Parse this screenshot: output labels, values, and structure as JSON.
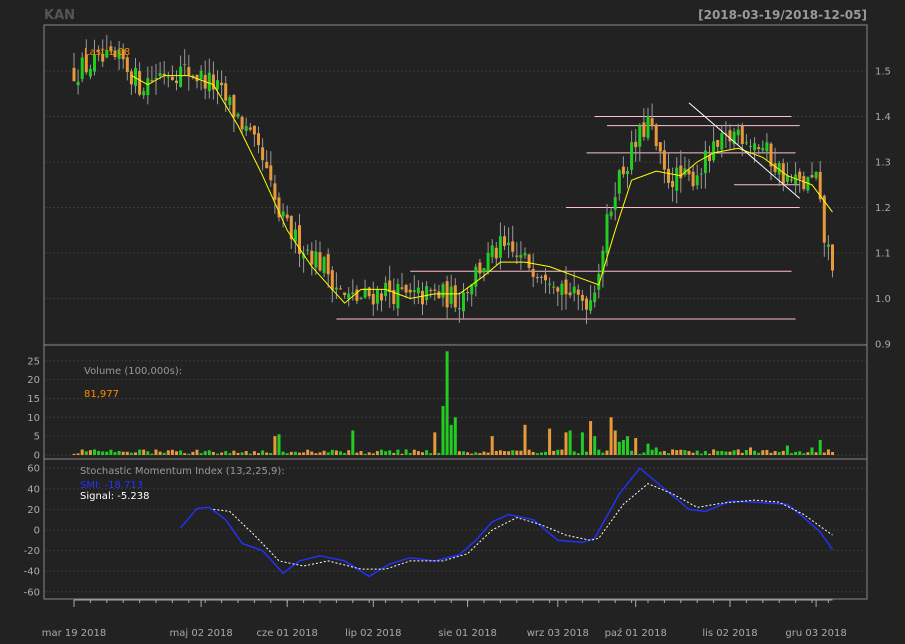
{
  "header": {
    "symbol": "KAN",
    "range": "[2018-03-19/2018-12-05]"
  },
  "colors": {
    "background": "#222222",
    "panel_border": "#888888",
    "grid": "#3a3a3a",
    "axis_text": "#aaaaaa",
    "up": "#22cc22",
    "down": "#e89a3a",
    "wick": "#999999",
    "sma": "#ffff00",
    "hline": "#ffc0cb",
    "trend": "#ffffff",
    "smi": "#2233ff",
    "signal": "#ffffff",
    "legend_text": "#bbbbbb",
    "last_text": "#ff8c00"
  },
  "chart_data": [
    {
      "type": "candlestick",
      "name": "price",
      "last_label": "Last 1.08",
      "ylim": [
        0.9,
        1.58
      ],
      "yticks": [
        "0.9",
        "1.0",
        "1.1",
        "1.2",
        "1.3",
        "1.4",
        "1.5"
      ],
      "xlabels": [
        "mar 19 2018",
        "maj 02 2018",
        "cze 01 2018",
        "lip 02 2018",
        "sie 01 2018",
        "wrz 03 2018",
        "paź 01 2018",
        "lis 02 2018",
        "gru 03 2018"
      ],
      "xlabel_index": [
        0,
        31,
        52,
        73,
        96,
        118,
        137,
        160,
        181
      ],
      "n_bars": 186,
      "close_keys": [
        [
          0,
          1.5
        ],
        [
          6,
          1.52
        ],
        [
          12,
          1.52
        ],
        [
          16,
          1.47
        ],
        [
          22,
          1.5
        ],
        [
          28,
          1.5
        ],
        [
          34,
          1.47
        ],
        [
          40,
          1.4
        ],
        [
          46,
          1.3
        ],
        [
          50,
          1.18
        ],
        [
          54,
          1.13
        ],
        [
          58,
          1.1
        ],
        [
          62,
          1.06
        ],
        [
          66,
          1.0
        ],
        [
          70,
          1.0
        ],
        [
          76,
          1.02
        ],
        [
          82,
          1.0
        ],
        [
          88,
          1.01
        ],
        [
          94,
          1.0
        ],
        [
          98,
          1.06
        ],
        [
          104,
          1.11
        ],
        [
          110,
          1.08
        ],
        [
          116,
          1.06
        ],
        [
          122,
          1.0
        ],
        [
          126,
          1.0
        ],
        [
          128,
          1.07
        ],
        [
          132,
          1.25
        ],
        [
          136,
          1.32
        ],
        [
          140,
          1.39
        ],
        [
          144,
          1.27
        ],
        [
          150,
          1.26
        ],
        [
          156,
          1.32
        ],
        [
          162,
          1.37
        ],
        [
          168,
          1.33
        ],
        [
          174,
          1.26
        ],
        [
          178,
          1.25
        ],
        [
          181,
          1.26
        ],
        [
          183,
          1.13
        ],
        [
          185,
          1.08
        ]
      ],
      "sma_keys": [
        [
          14,
          1.49
        ],
        [
          18,
          1.47
        ],
        [
          22,
          1.49
        ],
        [
          28,
          1.49
        ],
        [
          34,
          1.47
        ],
        [
          40,
          1.38
        ],
        [
          46,
          1.27
        ],
        [
          52,
          1.15
        ],
        [
          58,
          1.07
        ],
        [
          62,
          1.03
        ],
        [
          66,
          0.99
        ],
        [
          70,
          1.02
        ],
        [
          76,
          1.02
        ],
        [
          82,
          1.0
        ],
        [
          88,
          1.01
        ],
        [
          94,
          1.01
        ],
        [
          100,
          1.05
        ],
        [
          104,
          1.08
        ],
        [
          110,
          1.08
        ],
        [
          116,
          1.07
        ],
        [
          122,
          1.05
        ],
        [
          128,
          1.03
        ],
        [
          132,
          1.15
        ],
        [
          136,
          1.26
        ],
        [
          142,
          1.28
        ],
        [
          148,
          1.27
        ],
        [
          152,
          1.3
        ],
        [
          156,
          1.32
        ],
        [
          162,
          1.33
        ],
        [
          168,
          1.31
        ],
        [
          174,
          1.27
        ],
        [
          180,
          1.25
        ],
        [
          185,
          1.19
        ]
      ],
      "hlines": [
        [
          127,
          175,
          1.4
        ],
        [
          130,
          177,
          1.38
        ],
        [
          125,
          176,
          1.32
        ],
        [
          161,
          177,
          1.25
        ],
        [
          120,
          177,
          1.2
        ],
        [
          82,
          175,
          1.06
        ],
        [
          64,
          176,
          0.955
        ]
      ],
      "trendline": [
        [
          150,
          1.43
        ],
        [
          177,
          1.22
        ]
      ]
    },
    {
      "type": "bar",
      "name": "volume",
      "label": "Volume (100,000s):",
      "last_label": "81,977",
      "ylim": [
        0,
        28
      ],
      "yticks": [
        "0",
        "5",
        "10",
        "15",
        "20",
        "25"
      ],
      "spikes": [
        [
          49,
          5
        ],
        [
          50,
          5.5
        ],
        [
          68,
          6.5
        ],
        [
          88,
          6
        ],
        [
          90,
          13
        ],
        [
          91,
          27.5
        ],
        [
          92,
          8
        ],
        [
          93,
          10
        ],
        [
          102,
          5
        ],
        [
          110,
          8
        ],
        [
          116,
          7
        ],
        [
          120,
          6
        ],
        [
          121,
          6.5
        ],
        [
          124,
          6
        ],
        [
          126,
          9
        ],
        [
          127,
          5
        ],
        [
          131,
          10
        ],
        [
          132,
          6.5
        ],
        [
          133,
          3.5
        ],
        [
          134,
          4
        ],
        [
          135,
          5
        ],
        [
          137,
          4.5
        ],
        [
          140,
          3
        ],
        [
          142,
          2
        ],
        [
          165,
          2
        ],
        [
          174,
          2.5
        ],
        [
          180,
          2
        ],
        [
          182,
          4
        ],
        [
          185,
          0.8
        ]
      ]
    },
    {
      "type": "line",
      "name": "smi",
      "label": "Stochastic Momentum Index (13,2,25,9):",
      "smi_label": "SMI: -18.713",
      "signal_label": "Signal: -5.238",
      "ylim": [
        -65,
        62
      ],
      "yticks": [
        "-60",
        "-40",
        "-20",
        "0",
        "20",
        "40",
        "60"
      ],
      "smi_keys": [
        [
          26,
          2
        ],
        [
          30,
          21
        ],
        [
          33,
          22
        ],
        [
          37,
          10
        ],
        [
          41,
          -13
        ],
        [
          46,
          -20
        ],
        [
          51,
          -42
        ],
        [
          55,
          -30
        ],
        [
          60,
          -25
        ],
        [
          66,
          -30
        ],
        [
          72,
          -45
        ],
        [
          77,
          -33
        ],
        [
          82,
          -27
        ],
        [
          88,
          -30
        ],
        [
          94,
          -24
        ],
        [
          98,
          -10
        ],
        [
          102,
          8
        ],
        [
          106,
          15
        ],
        [
          112,
          10
        ],
        [
          118,
          -10
        ],
        [
          124,
          -12
        ],
        [
          127,
          -8
        ],
        [
          133,
          35
        ],
        [
          138,
          60
        ],
        [
          144,
          40
        ],
        [
          150,
          20
        ],
        [
          154,
          18
        ],
        [
          160,
          28
        ],
        [
          166,
          27
        ],
        [
          174,
          25
        ],
        [
          178,
          12
        ],
        [
          182,
          -2
        ],
        [
          185,
          -19
        ]
      ],
      "signal_keys": [
        [
          34,
          20
        ],
        [
          38,
          18
        ],
        [
          44,
          -5
        ],
        [
          50,
          -30
        ],
        [
          56,
          -35
        ],
        [
          62,
          -30
        ],
        [
          70,
          -38
        ],
        [
          76,
          -38
        ],
        [
          82,
          -30
        ],
        [
          90,
          -30
        ],
        [
          96,
          -23
        ],
        [
          102,
          0
        ],
        [
          108,
          12
        ],
        [
          114,
          5
        ],
        [
          120,
          -5
        ],
        [
          126,
          -10
        ],
        [
          128,
          -8
        ],
        [
          134,
          25
        ],
        [
          140,
          45
        ],
        [
          146,
          35
        ],
        [
          152,
          22
        ],
        [
          158,
          26
        ],
        [
          166,
          29
        ],
        [
          172,
          27
        ],
        [
          178,
          15
        ],
        [
          185,
          -5
        ]
      ]
    }
  ]
}
